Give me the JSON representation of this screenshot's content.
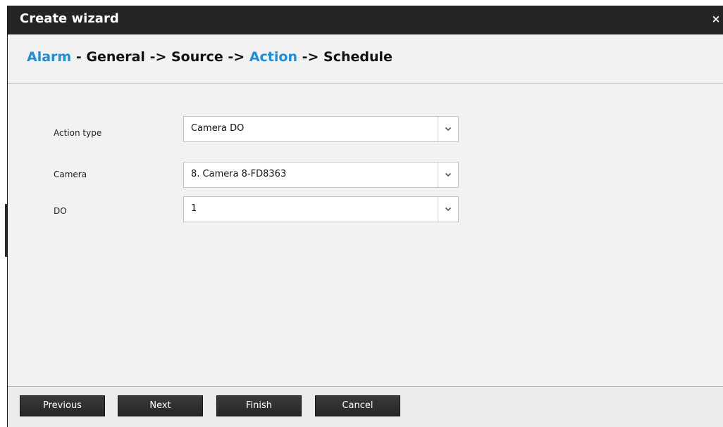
{
  "dialog": {
    "title": "Create wizard",
    "close_label": "×"
  },
  "breadcrumb": {
    "step1": "Alarm",
    "sep1": " - ",
    "step2": "General",
    "sep2": " -> ",
    "step3": "Source",
    "sep3": " -> ",
    "step4": "Action",
    "sep4": " -> ",
    "step5": "Schedule",
    "active_color": "#1f8dd6"
  },
  "form": {
    "action_type": {
      "label": "Action type",
      "value": "Camera DO"
    },
    "camera": {
      "label": "Camera",
      "value": "8. Camera 8-FD8363"
    },
    "do": {
      "label": "DO",
      "value": "1"
    }
  },
  "footer": {
    "previous": "Previous",
    "next": "Next",
    "finish": "Finish",
    "cancel": "Cancel"
  },
  "icons": {
    "close": "close-icon",
    "dropdown": "chevron-down-icon"
  }
}
